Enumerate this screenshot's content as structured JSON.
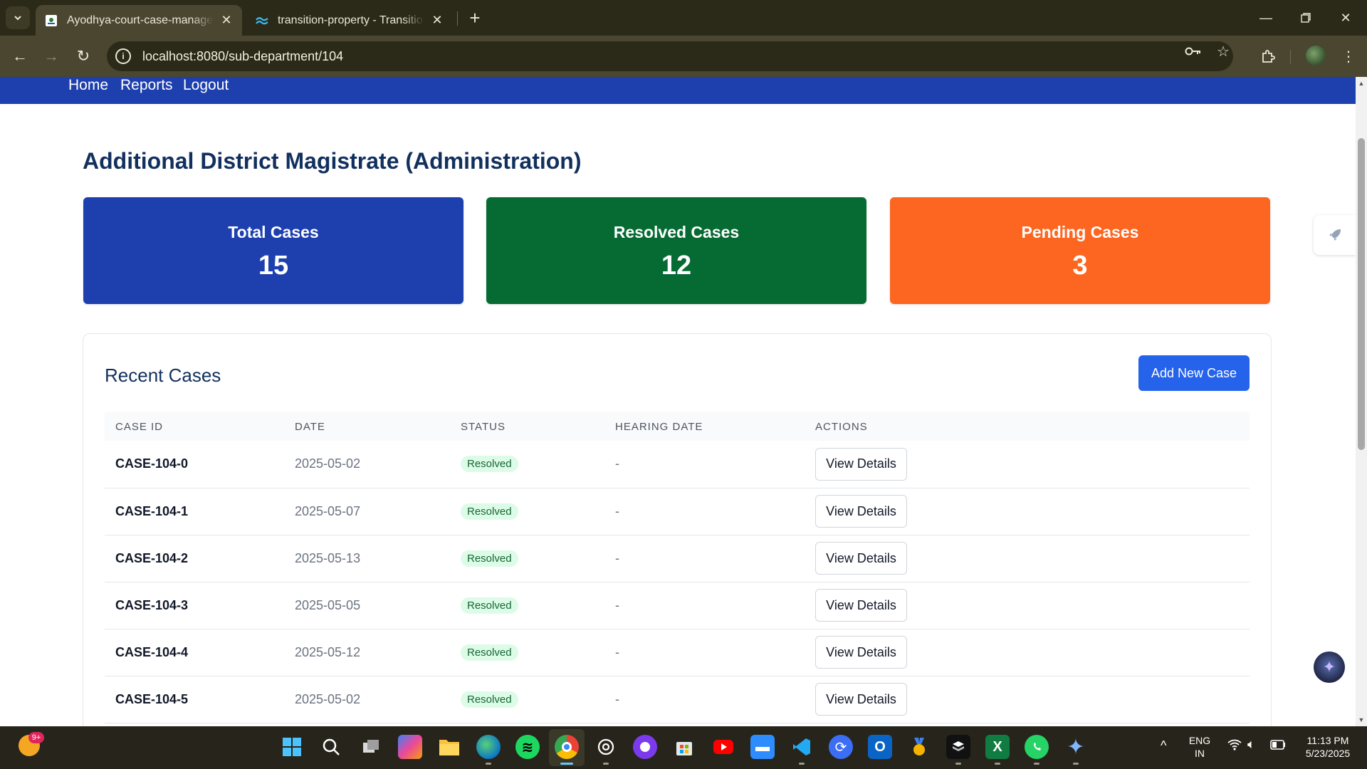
{
  "browser": {
    "tabs": [
      {
        "title": "Ayodhya-court-case-manageme",
        "active": true
      },
      {
        "title": "transition-property - Transitions",
        "active": false
      }
    ],
    "url": "localhost:8080/sub-department/104"
  },
  "nav": {
    "links": [
      "Home",
      "Reports",
      "Logout"
    ]
  },
  "page": {
    "title": "Additional District Magistrate (Administration)"
  },
  "stats": [
    {
      "label": "Total Cases",
      "value": "15",
      "color": "#1e40af"
    },
    {
      "label": "Resolved Cases",
      "value": "12",
      "color": "#066b33"
    },
    {
      "label": "Pending Cases",
      "value": "3",
      "color": "#fd6620"
    }
  ],
  "recent_cases": {
    "title": "Recent Cases",
    "add_button": "Add New Case",
    "columns": [
      "CASE ID",
      "DATE",
      "STATUS",
      "HEARING DATE",
      "ACTIONS"
    ],
    "rows": [
      {
        "case_id": "CASE-104-0",
        "date": "2025-05-02",
        "status": "Resolved",
        "hearing_date": "-",
        "action": "View Details"
      },
      {
        "case_id": "CASE-104-1",
        "date": "2025-05-07",
        "status": "Resolved",
        "hearing_date": "-",
        "action": "View Details"
      },
      {
        "case_id": "CASE-104-2",
        "date": "2025-05-13",
        "status": "Resolved",
        "hearing_date": "-",
        "action": "View Details"
      },
      {
        "case_id": "CASE-104-3",
        "date": "2025-05-05",
        "status": "Resolved",
        "hearing_date": "-",
        "action": "View Details"
      },
      {
        "case_id": "CASE-104-4",
        "date": "2025-05-12",
        "status": "Resolved",
        "hearing_date": "-",
        "action": "View Details"
      },
      {
        "case_id": "CASE-104-5",
        "date": "2025-05-02",
        "status": "Resolved",
        "hearing_date": "-",
        "action": "View Details"
      }
    ]
  },
  "taskbar": {
    "weather_badge": "9+",
    "language": "ENG",
    "region": "IN",
    "time": "11:13 PM",
    "date": "5/23/2025",
    "apps": [
      "windows-start-icon",
      "search-icon",
      "task-view-icon",
      "copilot-icon",
      "file-explorer-icon",
      "edge-icon",
      "spotify-icon",
      "chrome-icon",
      "chatgpt-icon",
      "github-icon",
      "microsoft-store-icon",
      "youtube-icon",
      "zoom-icon",
      "vscode-icon",
      "sync-icon",
      "outlook-icon",
      "medal-icon",
      "app-icon",
      "excel-icon",
      "whatsapp-icon",
      "gemini-icon"
    ]
  }
}
